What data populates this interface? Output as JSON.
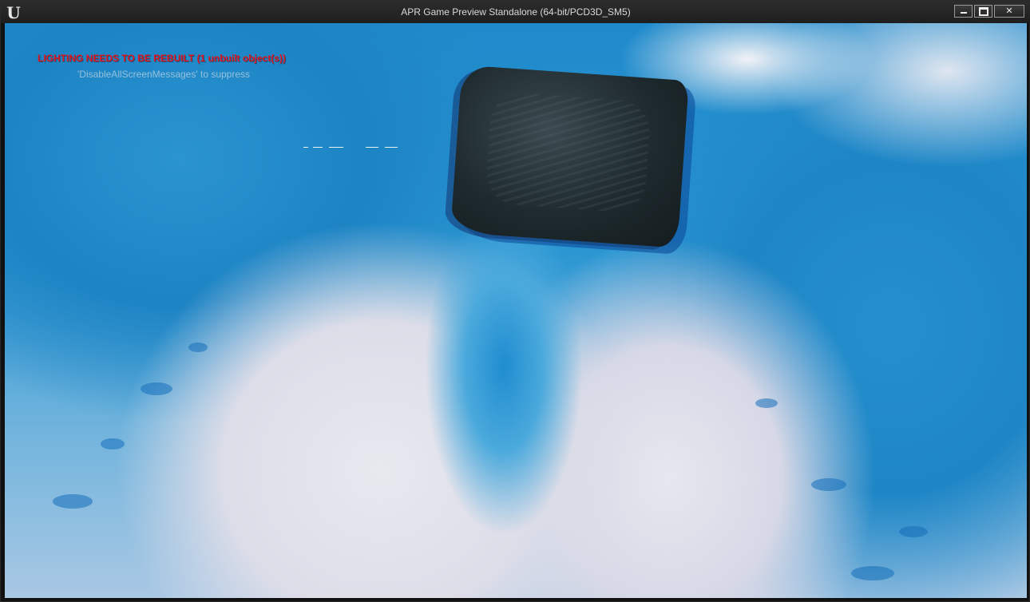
{
  "window": {
    "title": "APR Game Preview Standalone (64-bit/PCD3D_SM5)",
    "logo": "U",
    "controls": {
      "minimize_icon": "minimize-icon",
      "maximize_icon": "maximize-icon",
      "close_label": "✕"
    }
  },
  "viewport": {
    "messages": {
      "lighting": "LIGHTING NEEDS TO BE REBUILT (1 unbuilt object(s))",
      "suppress": "'DisableAllScreenMessages' to suppress"
    }
  },
  "colors": {
    "water_blue": "#1f8acb",
    "snow_white": "#e6e7ee",
    "rock_dark": "#1e2a2e",
    "warning_red": "#e0141e"
  }
}
